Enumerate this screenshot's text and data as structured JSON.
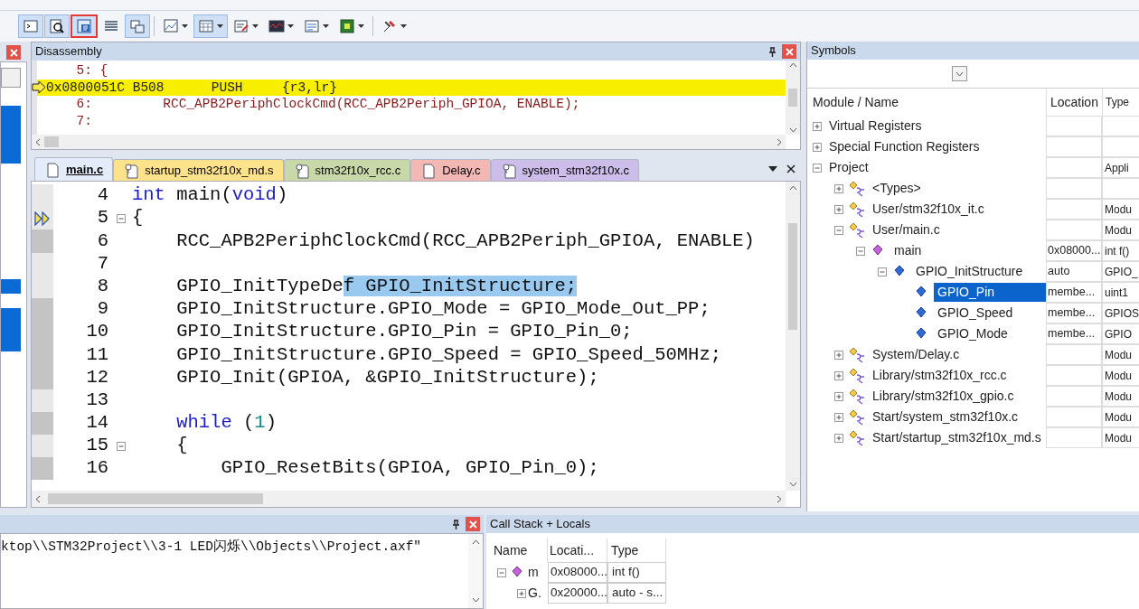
{
  "toolbar": {
    "buttons": [
      {
        "selected": true,
        "outlined": false,
        "dropdown": false
      },
      {
        "selected": true,
        "outlined": false,
        "dropdown": false
      },
      {
        "selected": true,
        "outlined": true,
        "dropdown": false
      },
      {
        "selected": false,
        "outlined": false,
        "dropdown": false
      },
      {
        "selected": true,
        "outlined": false,
        "dropdown": false
      },
      {
        "selected": false,
        "outlined": false,
        "dropdown": true
      },
      {
        "selected": true,
        "outlined": false,
        "dropdown": true
      },
      {
        "selected": false,
        "outlined": false,
        "dropdown": true
      },
      {
        "selected": false,
        "outlined": false,
        "dropdown": true
      },
      {
        "selected": false,
        "outlined": false,
        "dropdown": true
      },
      {
        "selected": false,
        "outlined": false,
        "dropdown": true
      },
      {
        "selected": false,
        "outlined": false,
        "dropdown": true
      }
    ]
  },
  "disassembly": {
    "title": "Disassembly",
    "lines": [
      {
        "kind": "source",
        "text": "     5: {",
        "current": false
      },
      {
        "kind": "asm",
        "text": "0x0800051C B508      PUSH     {r3,lr}",
        "current": true
      },
      {
        "kind": "source",
        "text": "     6:         RCC_APB2PeriphClockCmd(RCC_APB2Periph_GPIOA, ENABLE);",
        "current": false
      },
      {
        "kind": "source",
        "text": "     7:",
        "current": false
      }
    ]
  },
  "editor": {
    "tabs": [
      {
        "label": "main.c",
        "selected": true,
        "kind": "source",
        "color": "#e3ecf8"
      },
      {
        "label": "startup_stm32f10x_md.s",
        "selected": false,
        "kind": "locked",
        "color": "#fde28c"
      },
      {
        "label": "stm32f10x_rcc.c",
        "selected": false,
        "kind": "locked",
        "color": "#c8d8a8"
      },
      {
        "label": "Delay.c",
        "selected": false,
        "kind": "source",
        "color": "#f3b8b3"
      },
      {
        "label": "system_stm32f10x.c",
        "selected": false,
        "kind": "locked",
        "color": "#cdbdea"
      }
    ],
    "lines": [
      {
        "number": "4",
        "current": false,
        "executable": false,
        "fold": false,
        "segments": [
          {
            "text": "int",
            "kind": "keyword"
          },
          {
            "text": " main(",
            "kind": "plain"
          },
          {
            "text": "void",
            "kind": "keyword"
          },
          {
            "text": ")",
            "kind": "plain"
          }
        ]
      },
      {
        "number": "5",
        "current": true,
        "executable": false,
        "fold": true,
        "segments": [
          {
            "text": "{",
            "kind": "plain"
          }
        ]
      },
      {
        "number": "6",
        "current": false,
        "executable": true,
        "fold": false,
        "segments": [
          {
            "text": "    RCC_APB2PeriphClockCmd(RCC_APB2Periph_GPIOA, ENABLE)",
            "kind": "plain"
          }
        ]
      },
      {
        "number": "7",
        "current": false,
        "executable": false,
        "fold": false
      },
      {
        "number": "8",
        "current": false,
        "executable": false,
        "fold": false,
        "segments": [
          {
            "text": "    GPIO_InitTypeDe",
            "kind": "plain"
          },
          {
            "text": "f GPIO_InitStructure;",
            "kind": "selected"
          }
        ]
      },
      {
        "number": "9",
        "current": false,
        "executable": true,
        "fold": false,
        "segments": [
          {
            "text": "    GPIO_InitStructure.GPIO_Mode = GPIO_Mode_Out_PP;",
            "kind": "plain"
          }
        ]
      },
      {
        "number": "10",
        "current": false,
        "executable": true,
        "fold": false,
        "segments": [
          {
            "text": "    GPIO_InitStructure.GPIO_Pin = GPIO_Pin_0;",
            "kind": "plain"
          }
        ]
      },
      {
        "number": "11",
        "current": false,
        "executable": true,
        "fold": false,
        "segments": [
          {
            "text": "    GPIO_InitStructure.GPIO_Speed = GPIO_Speed_50MHz;",
            "kind": "plain"
          }
        ]
      },
      {
        "number": "12",
        "current": false,
        "executable": true,
        "fold": false,
        "segments": [
          {
            "text": "    GPIO_Init(GPIOA, &GPIO_InitStructure);",
            "kind": "plain"
          }
        ]
      },
      {
        "number": "13",
        "current": false,
        "executable": false,
        "fold": false
      },
      {
        "number": "14",
        "current": false,
        "executable": true,
        "fold": false,
        "segments": [
          {
            "text": "    while",
            "kind": "keyword"
          },
          {
            "text": " (",
            "kind": "plain"
          },
          {
            "text": "1",
            "kind": "number"
          },
          {
            "text": ")",
            "kind": "plain"
          }
        ]
      },
      {
        "number": "15",
        "current": false,
        "executable": false,
        "fold": true,
        "segments": [
          {
            "text": "    {",
            "kind": "plain"
          }
        ]
      },
      {
        "number": "16",
        "current": false,
        "executable": true,
        "fold": false,
        "segments": [
          {
            "text": "        GPIO_ResetBits(GPIOA, GPIO_Pin_0);",
            "kind": "plain"
          }
        ]
      }
    ]
  },
  "symbols": {
    "title": "Symbols",
    "columns": [
      "Module / Name",
      "Location",
      "Type"
    ],
    "items": [
      {
        "label": "Virtual Registers",
        "expanded": false,
        "selected": false
      },
      {
        "label": "Special Function Registers",
        "expanded": false,
        "selected": false
      },
      {
        "label": "Project",
        "expanded": true,
        "selected": false,
        "type": "Appli",
        "children": [
          {
            "label": "<Types>",
            "kind": "module",
            "expanded": false,
            "selected": false
          },
          {
            "label": "User/stm32f10x_it.c",
            "kind": "module",
            "expanded": false,
            "selected": false,
            "type": "Modu"
          },
          {
            "label": "User/main.c",
            "kind": "module",
            "expanded": true,
            "selected": false,
            "type": "Modu",
            "children": [
              {
                "label": "main",
                "kind": "function",
                "expanded": true,
                "selected": false,
                "location": "0x08000...",
                "type": "int f()",
                "children": [
                  {
                    "label": "GPIO_InitStructure",
                    "kind": "variable",
                    "expanded": true,
                    "selected": false,
                    "location": "auto",
                    "type": "GPIO_",
                    "children": [
                      {
                        "label": "GPIO_Pin",
                        "kind": "variable",
                        "selected": true,
                        "location": "membe...",
                        "type": "uint1"
                      },
                      {
                        "label": "GPIO_Speed",
                        "kind": "variable",
                        "selected": false,
                        "location": "membe...",
                        "type": "GPIOS"
                      },
                      {
                        "label": "GPIO_Mode",
                        "kind": "variable",
                        "selected": false,
                        "location": "membe...",
                        "type": "GPIO"
                      }
                    ]
                  }
                ]
              }
            ]
          },
          {
            "label": "System/Delay.c",
            "kind": "module",
            "expanded": false,
            "selected": false,
            "type": "Modu"
          },
          {
            "label": "Library/stm32f10x_rcc.c",
            "kind": "module",
            "expanded": false,
            "selected": false,
            "type": "Modu"
          },
          {
            "label": "Library/stm32f10x_gpio.c",
            "kind": "module",
            "expanded": false,
            "selected": false,
            "type": "Modu"
          },
          {
            "label": "Start/system_stm32f10x.c",
            "kind": "module",
            "expanded": false,
            "selected": false,
            "type": "Modu"
          },
          {
            "label": "Start/startup_stm32f10x_md.s",
            "kind": "module",
            "expanded": false,
            "selected": false,
            "type": "Modu"
          }
        ]
      }
    ]
  },
  "command": {
    "text": "ktop\\\\STM32Project\\\\3-1 LED闪烁\\\\Objects\\\\Project.axf\""
  },
  "callstack": {
    "title": "Call Stack + Locals",
    "columns": [
      "Name",
      "Locati...",
      "Type"
    ],
    "rows": [
      {
        "name": "m",
        "location": "0x08000...",
        "type": "int f()",
        "kind": "function",
        "expanded": true
      },
      {
        "name": "G.",
        "location": "0x20000...",
        "type": "auto - s...",
        "expanded": false
      }
    ]
  }
}
